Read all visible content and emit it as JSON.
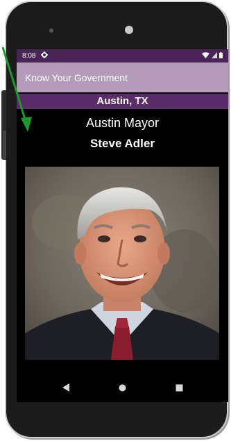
{
  "status_bar": {
    "time": "8:08",
    "settings_icon": "gear-icon",
    "wifi_icon": "wifi-icon",
    "signal_icon": "cell-signal-icon",
    "battery_icon": "battery-icon"
  },
  "app_bar": {
    "title": "Know Your Government"
  },
  "location": {
    "label": "Austin, TX"
  },
  "official": {
    "office": "Austin Mayor",
    "name": "Steve Adler"
  },
  "nav_bar": {
    "back_icon": "back-triangle-icon",
    "home_icon": "home-circle-icon",
    "recents_icon": "recents-square-icon"
  },
  "colors": {
    "status_bar": "#4a2357",
    "app_bar": "#b39bb9",
    "location_band": "#5a2d68",
    "annotation_arrow": "#1a9a2a"
  }
}
